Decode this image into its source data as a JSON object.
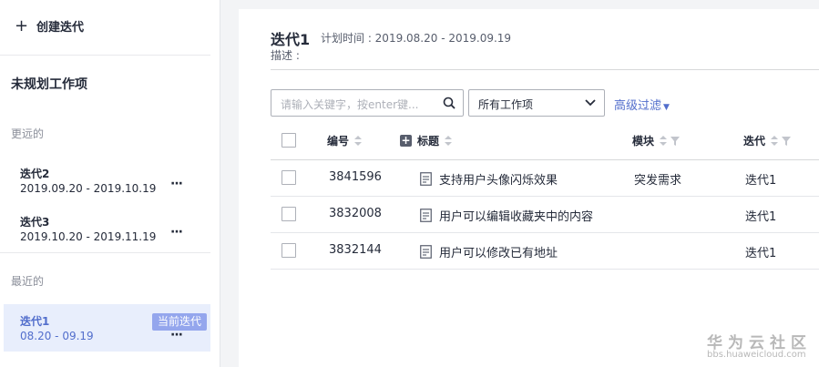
{
  "sidebar": {
    "create_label": "创建迭代",
    "unplanned_label": "未规划工作项",
    "groups": [
      {
        "label": "更远的"
      },
      {
        "label": "最近的"
      }
    ],
    "iterations": [
      {
        "name": "迭代2",
        "dates": "2019.09.20 - 2019.10.19",
        "more": "···"
      },
      {
        "name": "迭代3",
        "dates": "2019.10.20 - 2019.11.19",
        "more": "···"
      },
      {
        "name": "迭代1",
        "dates": "08.20 - 09.19",
        "more": "···",
        "badge": "当前迭代"
      }
    ]
  },
  "header": {
    "title": "迭代1",
    "plan_time": "计划时间 : 2019.08.20 - 2019.09.19",
    "description": "描述 :"
  },
  "toolbar": {
    "search_placeholder": "请输入关键字，按enter键...",
    "filter_value": "所有工作项",
    "advanced_label": "高级过滤"
  },
  "table": {
    "columns": [
      "编号",
      "标题",
      "模块",
      "迭代"
    ],
    "rows": [
      {
        "id": "3841596",
        "title": "支持用户头像闪烁效果",
        "module": "突发需求",
        "iteration": "迭代1"
      },
      {
        "id": "3832008",
        "title": "用户可以编辑收藏夹中的内容",
        "module": "",
        "iteration": "迭代1"
      },
      {
        "id": "3832144",
        "title": "用户可以修改已有地址",
        "module": "",
        "iteration": "迭代1"
      }
    ]
  },
  "watermark": {
    "brand": "华为云社区",
    "url": "bbs.huaweicloud.com"
  },
  "colors": {
    "accent": "#526ecc",
    "active_bg": "#e8eefc",
    "badge_bg": "#94a6ed"
  }
}
